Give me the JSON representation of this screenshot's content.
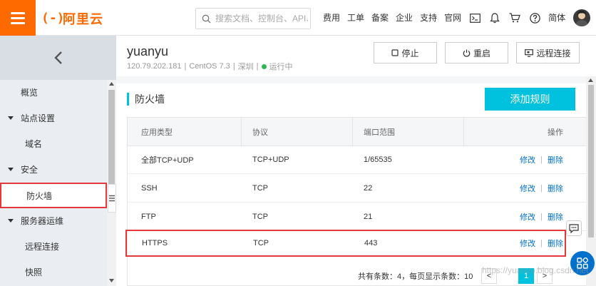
{
  "brand": {
    "logo_mark": "(-)",
    "logo_text": "阿里云",
    "accent": "#ff6a00"
  },
  "search": {
    "placeholder": "搜索文档、控制台、API、"
  },
  "nav": {
    "items": [
      "费用",
      "工单",
      "备案",
      "企业",
      "支持",
      "官网"
    ],
    "lang": "简体"
  },
  "sidebar": {
    "items": [
      {
        "label": "概览",
        "type": "item"
      },
      {
        "label": "站点设置",
        "type": "group"
      },
      {
        "label": "域名",
        "type": "sub"
      },
      {
        "label": "安全",
        "type": "group"
      },
      {
        "label": "防火墙",
        "type": "sub",
        "active": true
      },
      {
        "label": "服务器运维",
        "type": "group"
      },
      {
        "label": "远程连接",
        "type": "sub"
      },
      {
        "label": "快照",
        "type": "sub"
      }
    ]
  },
  "instance": {
    "name": "yuanyu",
    "ip": "120.79.202.181",
    "os": "CentOS 7.3",
    "region": "深圳",
    "status": "运行中",
    "status_color": "#2db84d",
    "sep": "|"
  },
  "actions": {
    "stop": "停止",
    "restart": "重启",
    "remote": "远程连接"
  },
  "firewall": {
    "title": "防火墙",
    "add_button": "添加规则",
    "columns": [
      "应用类型",
      "协议",
      "端口范围",
      "操作"
    ],
    "rows": [
      {
        "app": "全部TCP+UDP",
        "protocol": "TCP+UDP",
        "port": "1/65535",
        "edit": "修改",
        "delete": "删除"
      },
      {
        "app": "SSH",
        "protocol": "TCP",
        "port": "22",
        "edit": "修改",
        "delete": "删除"
      },
      {
        "app": "FTP",
        "protocol": "TCP",
        "port": "21",
        "edit": "修改",
        "delete": "删除"
      },
      {
        "app": "HTTPS",
        "protocol": "TCP",
        "port": "443",
        "edit": "修改",
        "delete": "删除",
        "highlighted": true
      }
    ],
    "ops_sep": "|",
    "pager_text": "共有条数：4，每页显示条数：10",
    "page_prev": "<",
    "page_current": "1",
    "page_next": ">"
  },
  "watermark": "https://yuanyu.blog.csdn.net"
}
